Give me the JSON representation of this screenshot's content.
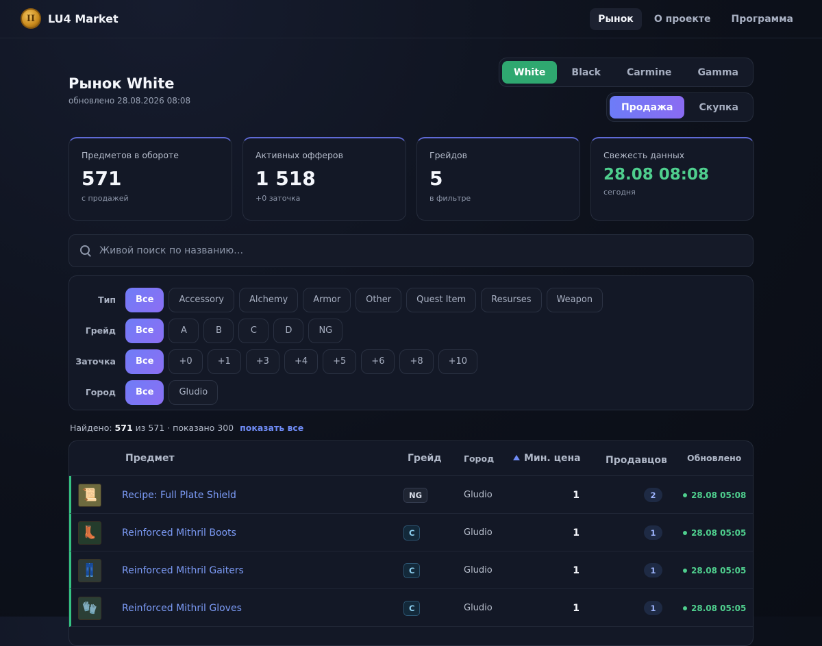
{
  "header": {
    "brand": "LU4 Market",
    "logo_glyph": "II",
    "nav": [
      {
        "label": "Рынок",
        "active": true
      },
      {
        "label": "О проекте",
        "active": false
      },
      {
        "label": "Программа",
        "active": false
      }
    ]
  },
  "page": {
    "title": "Рынок White",
    "updated": "обновлено 28.08.2026 08:08"
  },
  "servers": [
    {
      "label": "White",
      "active": true
    },
    {
      "label": "Black",
      "active": false
    },
    {
      "label": "Carmine",
      "active": false
    },
    {
      "label": "Gamma",
      "active": false
    }
  ],
  "modes": [
    {
      "label": "Продажа",
      "active": true
    },
    {
      "label": "Скупка",
      "active": false
    }
  ],
  "stats": [
    {
      "label": "Предметов в обороте",
      "value": "571",
      "hint": "с продажей"
    },
    {
      "label": "Активных офферов",
      "value": "1 518",
      "hint": "+0 заточка"
    },
    {
      "label": "Грейдов",
      "value": "5",
      "hint": "в фильтре"
    },
    {
      "label": "Свежесть данных",
      "value": "28.08 08:08",
      "hint": "сегодня"
    }
  ],
  "search": {
    "placeholder": "Живой поиск по названию…",
    "value": ""
  },
  "filters": [
    {
      "label": "Тип",
      "options": [
        "Все",
        "Accessory",
        "Alchemy",
        "Armor",
        "Other",
        "Quest Item",
        "Resurses",
        "Weapon"
      ],
      "selected": "Все"
    },
    {
      "label": "Грейд",
      "options": [
        "Все",
        "A",
        "B",
        "C",
        "D",
        "NG"
      ],
      "selected": "Все"
    },
    {
      "label": "Заточка",
      "options": [
        "Все",
        "+0",
        "+1",
        "+3",
        "+4",
        "+5",
        "+6",
        "+8",
        "+10"
      ],
      "selected": "Все"
    },
    {
      "label": "Город",
      "options": [
        "Все",
        "Gludio"
      ],
      "selected": "Все"
    }
  ],
  "found": {
    "prefix": "Найдено:",
    "count": "571",
    "middle": "из 571 · показано 300",
    "show_all": "показать все"
  },
  "table": {
    "columns": {
      "item": "Предмет",
      "grade": "Грейд",
      "city": "Город",
      "price": "Мин. цена",
      "sellers": "Продавцов",
      "updated": "Обновлено"
    },
    "rows": [
      {
        "name": "Recipe: Full Plate Shield",
        "grade": "NG",
        "city": "Gludio",
        "price": "1",
        "sellers": "2",
        "updated": "28.08 05:08",
        "icon": "scroll-icon",
        "glyph": "📜",
        "bg": "#6d6a3e"
      },
      {
        "name": "Reinforced Mithril Boots",
        "grade": "C",
        "city": "Gludio",
        "price": "1",
        "sellers": "1",
        "updated": "28.08 05:05",
        "icon": "boots-icon",
        "glyph": "👢",
        "bg": "#243c2c"
      },
      {
        "name": "Reinforced Mithril Gaiters",
        "grade": "C",
        "city": "Gludio",
        "price": "1",
        "sellers": "1",
        "updated": "28.08 05:05",
        "icon": "gaiters-icon",
        "glyph": "👖",
        "bg": "#2e3a36"
      },
      {
        "name": "Reinforced Mithril Gloves",
        "grade": "C",
        "city": "Gludio",
        "price": "1",
        "sellers": "1",
        "updated": "28.08 05:05",
        "icon": "gloves-icon",
        "glyph": "🧤",
        "bg": "#2b3f35"
      }
    ]
  }
}
